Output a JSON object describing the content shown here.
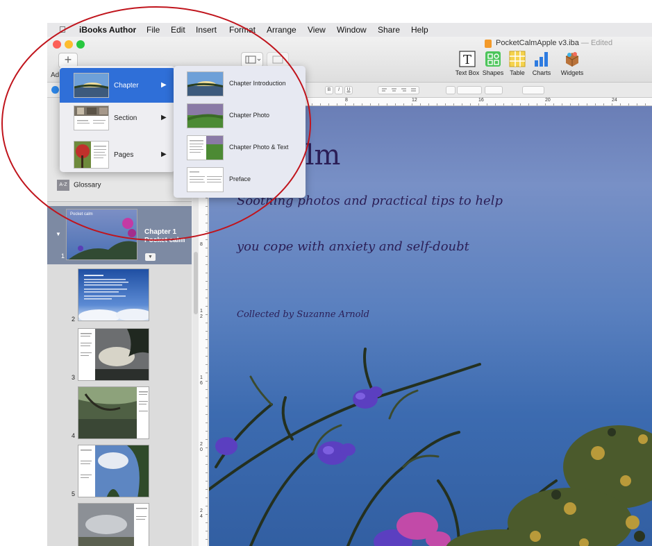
{
  "menubar": {
    "app_name": "iBooks Author",
    "items": [
      "File",
      "Edit",
      "Insert",
      "Format",
      "Arrange",
      "View",
      "Window",
      "Share",
      "Help"
    ]
  },
  "window": {
    "doc_name": "PocketCalmApple v3.iba",
    "doc_status": "— Edited",
    "add_label": "Ad",
    "add_symbol": "+"
  },
  "toolbar": {
    "text_box": "Text Box",
    "shapes": "Shapes",
    "table": "Table",
    "charts": "Charts",
    "widgets": "Widgets"
  },
  "formatbar": {
    "bold": "B",
    "italic": "I",
    "underline": "U"
  },
  "ruler": {
    "top_ticks": [
      "8",
      "12",
      "16",
      "20",
      "24"
    ],
    "left_ticks": [
      "8",
      "1\n2",
      "1\n6",
      "2\n0",
      "2\n4"
    ]
  },
  "add_menu": {
    "items": [
      {
        "label": "Chapter",
        "selected": true
      },
      {
        "label": "Section",
        "selected": false
      },
      {
        "label": "Pages",
        "selected": false
      }
    ],
    "arrow": "▶"
  },
  "chapter_submenu": {
    "items": [
      "Chapter Introduction",
      "Chapter Photo",
      "Chapter Photo & Text",
      "Preface"
    ]
  },
  "sidebar": {
    "glossary_label": "Glossary",
    "glossary_icon": "A-Z",
    "chapter": {
      "line1": "Chapter 1",
      "line2": "Pocket calm",
      "number": "1",
      "thumb_title": "Pocket calm"
    },
    "pages": [
      "2",
      "3",
      "4",
      "5"
    ]
  },
  "page": {
    "title": "et calm",
    "line1": "Soothing photos and practical tips to help",
    "line2": "you cope with anxiety and self-doubt",
    "byline": "Collected by Suzanne Arnold"
  },
  "colors": {
    "selection": "#2f6fd8",
    "annotation": "#c0141c",
    "title_text": "#2b1e56"
  }
}
